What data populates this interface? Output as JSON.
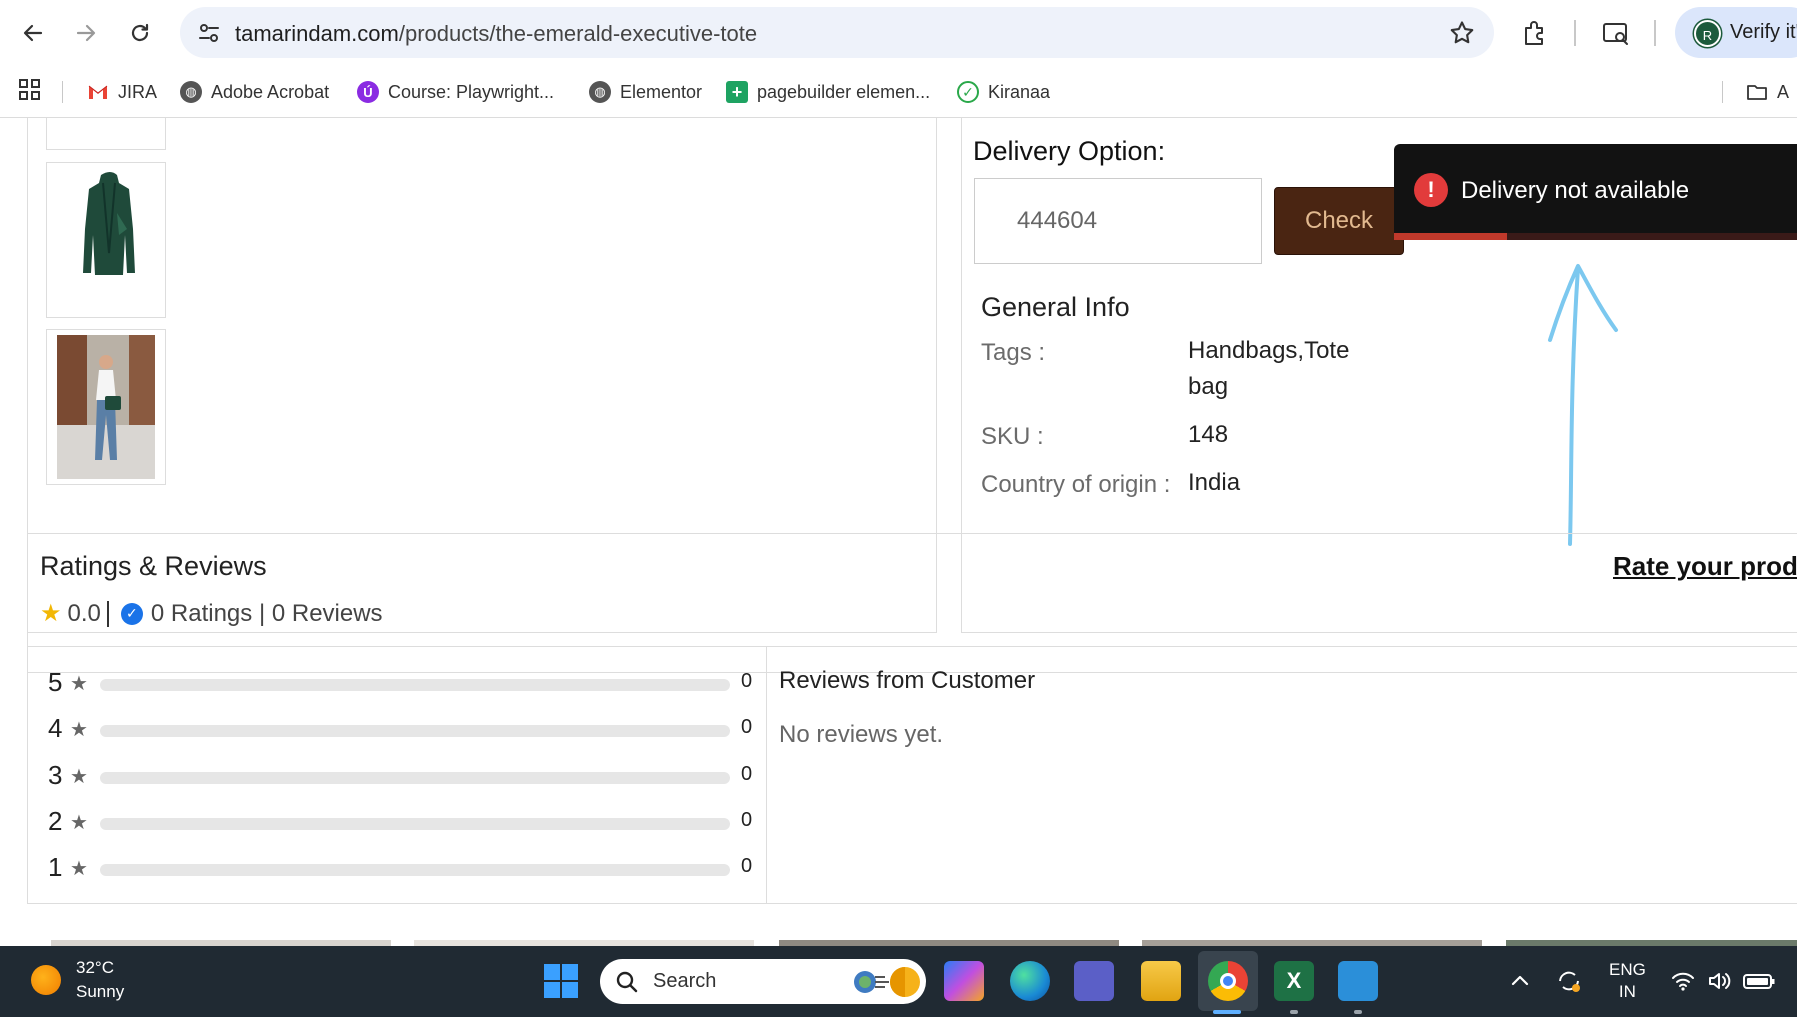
{
  "browser": {
    "url_domain": "tamarindam.com",
    "url_path": "/products/the-emerald-executive-tote",
    "profile_initial": "R",
    "profile_button_text": "Verify it's"
  },
  "bookmarks": [
    {
      "label": "JIRA",
      "icon": "gmail-icon"
    },
    {
      "label": "Adobe Acrobat",
      "icon": "globe-icon"
    },
    {
      "label": "Course: Playwright...",
      "icon": "udemy-icon"
    },
    {
      "label": "Elementor",
      "icon": "globe-icon"
    },
    {
      "label": "pagebuilder elemen...",
      "icon": "sheets-icon"
    },
    {
      "label": "Kiranaa",
      "icon": "check-circle-icon"
    },
    {
      "label": "A",
      "icon": "folder-icon"
    }
  ],
  "product": {
    "delivery_label": "Delivery Option:",
    "pincode_value": "444604",
    "check_label": "Check",
    "general_info_title": "General Info",
    "info": [
      {
        "key": "Tags :",
        "value": "Handbags,Tote bag"
      },
      {
        "key": "SKU :",
        "value": "148"
      },
      {
        "key": "Country of origin :",
        "value": "India"
      }
    ]
  },
  "toast": {
    "message": "Delivery not available",
    "progress": 0.27,
    "icon": "error-icon"
  },
  "ratings": {
    "title": "Ratings & Reviews",
    "rate_link": "Rate your prod",
    "average": "0.0",
    "summary": "0 Ratings | 0 Reviews",
    "rows": [
      {
        "stars": "5",
        "count": "0",
        "fraction": 0
      },
      {
        "stars": "4",
        "count": "0",
        "fraction": 0
      },
      {
        "stars": "3",
        "count": "0",
        "fraction": 0
      },
      {
        "stars": "2",
        "count": "0",
        "fraction": 0
      },
      {
        "stars": "1",
        "count": "0",
        "fraction": 0
      }
    ],
    "reviews_title": "Reviews from Customer",
    "reviews_empty": "No reviews yet."
  },
  "taskbar": {
    "temperature": "32°C",
    "condition": "Sunny",
    "search_placeholder": "Search",
    "lang_top": "ENG",
    "lang_bottom": "IN"
  },
  "colors": {
    "check_button": "#4a2512",
    "toast_bg": "#121212",
    "toast_error": "#e23b3b",
    "annotation": "#7cc8ef"
  }
}
